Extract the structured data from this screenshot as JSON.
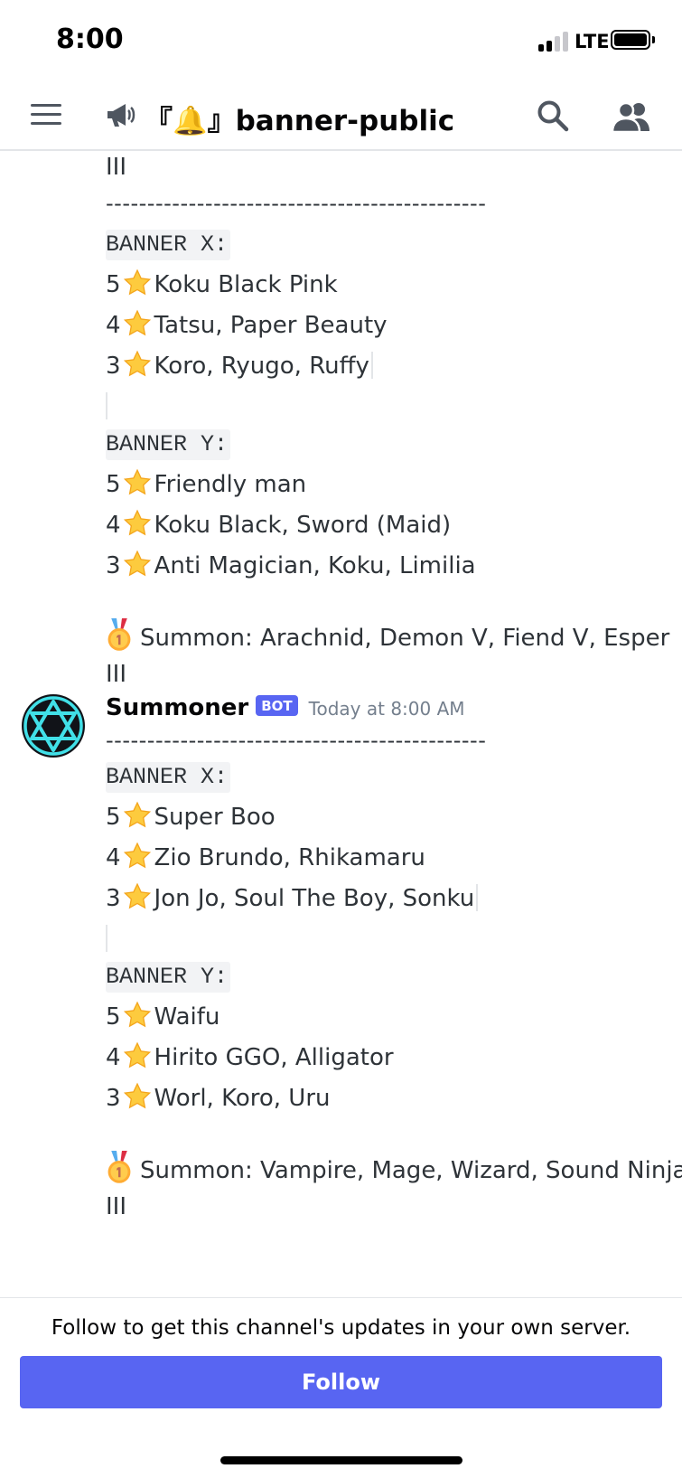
{
  "status_bar": {
    "time": "8:00",
    "carrier": "LTE"
  },
  "header": {
    "channel_icon": "announcement-megaphone-icon",
    "channel_name": "『🔔』banner-public",
    "icons": [
      "hamburger-menu-icon",
      "search-icon",
      "members-icon"
    ]
  },
  "message_1": {
    "continued_text": "III",
    "divider": "----------------------------------------------",
    "banner_x": {
      "label": "BANNER X:",
      "rows": [
        {
          "rank": "5",
          "names": "Koku Black Pink"
        },
        {
          "rank": "4",
          "names": "Tatsu, Paper Beauty"
        },
        {
          "rank": "3",
          "names": "Koro, Ryugo, Ruffy"
        }
      ]
    },
    "banner_y": {
      "label": "BANNER Y:",
      "rows": [
        {
          "rank": "5",
          "names": "Friendly man"
        },
        {
          "rank": "4",
          "names": "Koku Black, Sword (Maid)"
        },
        {
          "rank": "3",
          "names": "Anti Magician, Koku, Limilia"
        }
      ]
    },
    "summon_line1": "Summon: Arachnid, Demon V, Fiend V, Esper",
    "summon_line2": "III"
  },
  "message_2": {
    "author": "Summoner",
    "badge": "BOT",
    "timestamp": "Today at 8:00 AM",
    "avatar_icon": "hexagram-star-avatar-icon",
    "divider": "----------------------------------------------",
    "banner_x": {
      "label": "BANNER X:",
      "rows": [
        {
          "rank": "5",
          "names": "Super Boo"
        },
        {
          "rank": "4",
          "names": "Zio Brundo, Rhikamaru"
        },
        {
          "rank": "3",
          "names": "Jon Jo, Soul The Boy, Sonku"
        }
      ]
    },
    "banner_y": {
      "label": "BANNER Y:",
      "rows": [
        {
          "rank": "5",
          "names": "Waifu"
        },
        {
          "rank": "4",
          "names": "Hirito GGO, Alligator"
        },
        {
          "rank": "3",
          "names": "Worl, Koro, Uru"
        }
      ]
    },
    "summon_line1": "Summon: Vampire, Mage, Wizard, Sound Ninja",
    "summon_line2": "III"
  },
  "footer": {
    "follow_prompt": "Follow to get this channel's updates in your own server.",
    "follow_label": "Follow"
  },
  "colors": {
    "blurple": "#5865f2",
    "text": "#2e3338",
    "muted": "#747f8d",
    "star": "#fdcb3e",
    "avatar_ring": "#41e0e8"
  }
}
